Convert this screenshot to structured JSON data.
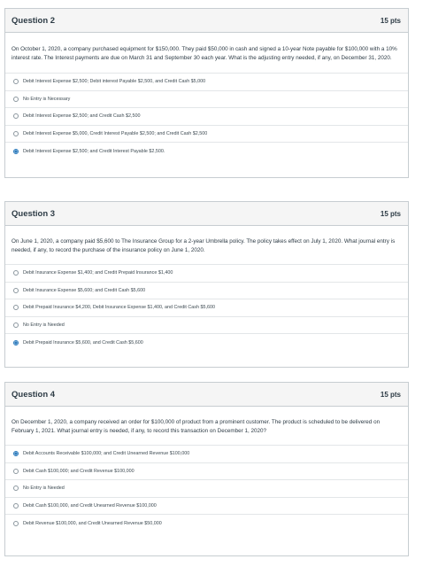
{
  "questions": [
    {
      "title": "Question 2",
      "points": "15 pts",
      "text": "On October 1, 2020, a company purchased equipment for $150,000. They paid $50,000 in cash and signed a 10-year Note payable for $100,000 with a 10% interest rate. The Interest payments are due on March 31 and September 30 each year. What is the adjusting entry needed, if any, on December 31, 2020.",
      "answers": [
        {
          "label": "Debit Interest Expense $2,500; Debit interest Payable $2,500, and Credit Cash $5,000",
          "selected": false
        },
        {
          "label": "No Entry is Necessary",
          "selected": false
        },
        {
          "label": "Debit Interest Expense $2,500; and Credit Cash $2,500",
          "selected": false
        },
        {
          "label": "Debit Interest Expense $5,000, Credit Interest Payable $2,500; and Credit Cash $2,500",
          "selected": false
        },
        {
          "label": "Debit Interest Expense $2,500; and Credit Interest Payable $2,500.",
          "selected": true
        }
      ]
    },
    {
      "title": "Question 3",
      "points": "15 pts",
      "text": "On June 1, 2020, a company paid $5,600 to The Insurance Group for a 2-year Umbrella policy. The policy takes effect on July 1, 2020. What journal entry is needed, if any, to record the purchase of the insurance policy on June 1, 2020.",
      "answers": [
        {
          "label": "Debit Insurance Expense $1,400; and Credit Prepaid Insurance $1,400",
          "selected": false
        },
        {
          "label": "Debit Insurance Expense $5,600; and Credit Cash $5,600",
          "selected": false
        },
        {
          "label": "Debit Prepaid Insurance $4,200, Debit Insurance Expense $1,400, and Credit Cash $5,600",
          "selected": false
        },
        {
          "label": "No Entry is Needed",
          "selected": false
        },
        {
          "label": "Debit Prepaid Insurance $5,600, and Credit Cash $5,600",
          "selected": true
        }
      ]
    },
    {
      "title": "Question 4",
      "points": "15 pts",
      "text": "On December 1, 2020, a company received an order for $100,000 of product from a prominent customer. The product is scheduled to be delivered on February 1, 2021. What journal entry is needed, if any, to record this transaction on December 1, 2020?",
      "answers": [
        {
          "label": "Debit Accounts Receivable $100,000; and Credit Unearned Revenue $100,000",
          "selected": true
        },
        {
          "label": "Debit Cash $100,000; and Credit Revenue $100,000",
          "selected": false
        },
        {
          "label": "No Entry is Needed",
          "selected": false
        },
        {
          "label": "Debit Cash $100,000, and Credit Unearned Revenue $100,000",
          "selected": false
        },
        {
          "label": "Debit Revenue $100,000, and Credit Unearned Revenue $50,000",
          "selected": false
        }
      ]
    }
  ]
}
